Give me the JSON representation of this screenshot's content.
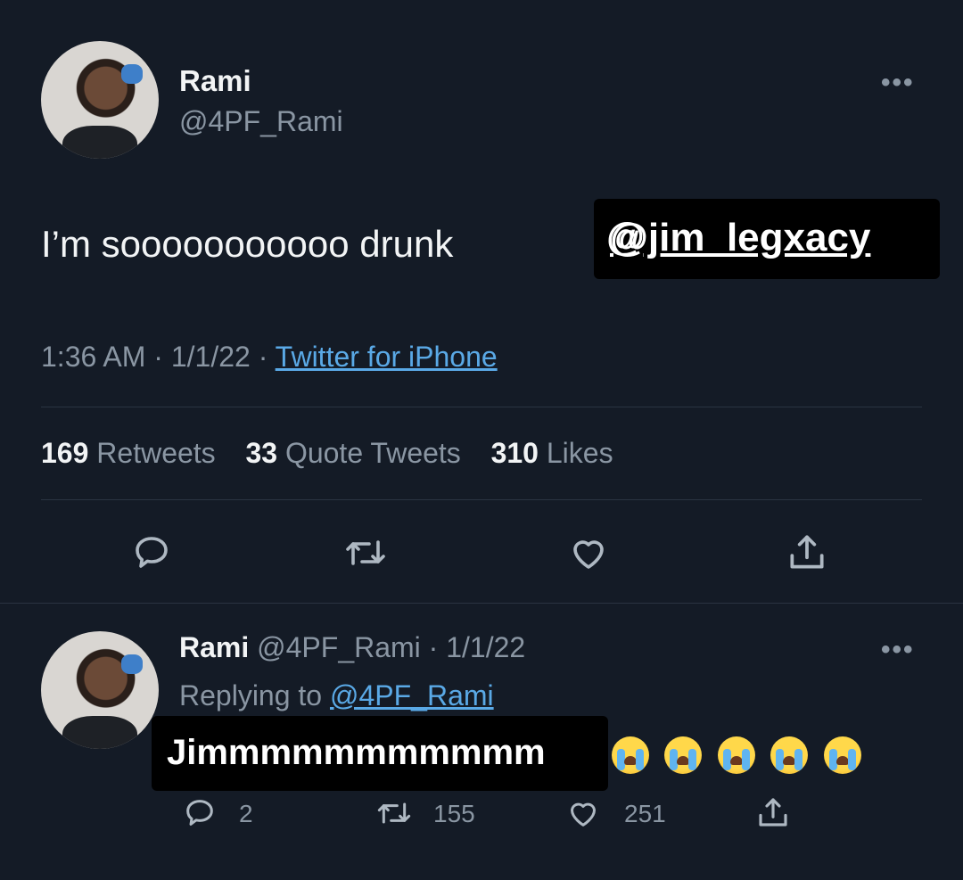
{
  "tweet": {
    "author_name": "Rami",
    "author_handle": "@4PF_Rami",
    "more_label": "•••",
    "text": "I’m sooooooooooo drunk",
    "time": "1:36 AM",
    "date": "1/1/22",
    "source": "Twitter for iPhone",
    "stats": {
      "retweets_count": "169",
      "retweets_label": "Retweets",
      "quotes_count": "33",
      "quotes_label": "Quote Tweets",
      "likes_count": "310",
      "likes_label": "Likes"
    },
    "sticker": "@jim_legxacy"
  },
  "reply": {
    "author_name": "Rami",
    "author_handle": "@4PF_Rami",
    "date": "1/1/22",
    "more_label": "•••",
    "replying_prefix": "Replying to",
    "replying_handle": "@4PF_Rami",
    "text": "Jimmmmmmmmmmm",
    "emoji_count": 5,
    "reply_count": "2",
    "retweet_count": "155",
    "like_count": "251"
  },
  "icons": {
    "reply": "reply-icon",
    "retweet": "retweet-icon",
    "like": "heart-icon",
    "share": "share-icon",
    "sticker_mark": "threads-icon"
  },
  "colors": {
    "background": "#141b26",
    "text_primary": "#f2f4f5",
    "text_secondary": "#8a96a3",
    "link": "#5aa9e6",
    "sticker_bg": "#000000"
  }
}
